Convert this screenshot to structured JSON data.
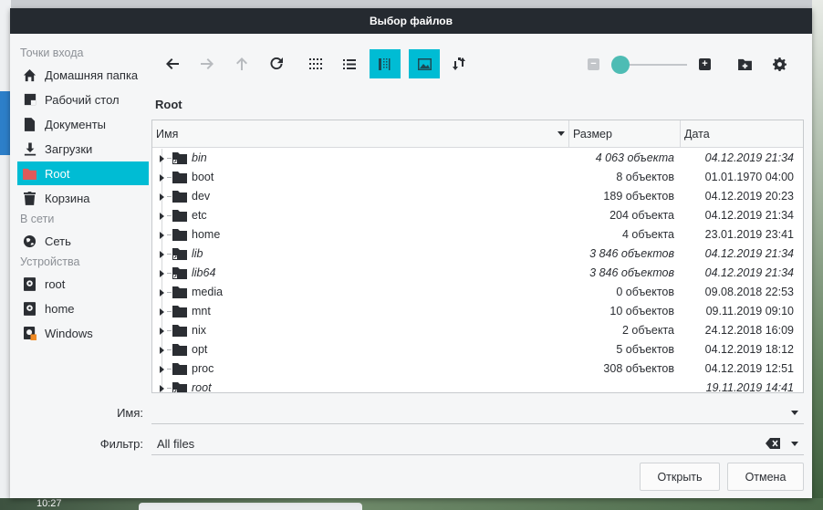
{
  "window": {
    "title": "Выбор файлов"
  },
  "sidebar": {
    "sections": {
      "places": "Точки входа",
      "network": "В сети",
      "devices": "Устройства"
    },
    "items": [
      {
        "label": "Домашняя папка",
        "icon": "home-icon"
      },
      {
        "label": "Рабочий стол",
        "icon": "desktop-icon"
      },
      {
        "label": "Документы",
        "icon": "document-icon"
      },
      {
        "label": "Загрузки",
        "icon": "download-icon"
      },
      {
        "label": "Root",
        "icon": "folder-icon",
        "active": true
      },
      {
        "label": "Корзина",
        "icon": "trash-icon"
      },
      {
        "label": "Сеть",
        "icon": "network-icon"
      },
      {
        "label": "root",
        "icon": "drive-icon"
      },
      {
        "label": "home",
        "icon": "drive-icon"
      },
      {
        "label": "Windows",
        "icon": "drive-windows-icon"
      }
    ]
  },
  "toolbar": {
    "buttons": [
      "back",
      "forward",
      "up",
      "reload",
      "icon-view",
      "list-view",
      "compact-view",
      "preview",
      "sort"
    ],
    "active_views": [
      "compact-view",
      "preview"
    ],
    "accent_color": "#00bcd4"
  },
  "location": {
    "path": "Root"
  },
  "table": {
    "columns": {
      "name": "Имя",
      "size": "Размер",
      "date": "Дата"
    },
    "rows": [
      {
        "name": "bin",
        "size": "4 063 объекта",
        "date": "04.12.2019 21:34",
        "link": true
      },
      {
        "name": "boot",
        "size": "8 объектов",
        "date": "01.01.1970 04:00",
        "link": false
      },
      {
        "name": "dev",
        "size": "189 объектов",
        "date": "04.12.2019 20:23",
        "link": false
      },
      {
        "name": "etc",
        "size": "204 объекта",
        "date": "04.12.2019 21:34",
        "link": false
      },
      {
        "name": "home",
        "size": "4 объекта",
        "date": "23.01.2019 23:41",
        "link": false
      },
      {
        "name": "lib",
        "size": "3 846 объектов",
        "date": "04.12.2019 21:34",
        "link": true
      },
      {
        "name": "lib64",
        "size": "3 846 объектов",
        "date": "04.12.2019 21:34",
        "link": true
      },
      {
        "name": "media",
        "size": "0 объектов",
        "date": "09.08.2018 22:53",
        "link": false
      },
      {
        "name": "mnt",
        "size": "10 объектов",
        "date": "09.11.2019 09:10",
        "link": false
      },
      {
        "name": "nix",
        "size": "2 объекта",
        "date": "24.12.2018 16:09",
        "link": false
      },
      {
        "name": "opt",
        "size": "5 объектов",
        "date": "04.12.2019 18:12",
        "link": false
      },
      {
        "name": "proc",
        "size": "308 объектов",
        "date": "04.12.2019 12:51",
        "link": false
      },
      {
        "name": "root",
        "size": "",
        "date": "19.11.2019 14:41",
        "link": true
      }
    ]
  },
  "form": {
    "name_label": "Имя:",
    "name_value": "",
    "filter_label": "Фильтр:",
    "filter_value": "All files"
  },
  "buttons": {
    "open": "Открыть",
    "cancel": "Отмена"
  },
  "background": {
    "clock": "10:27"
  }
}
